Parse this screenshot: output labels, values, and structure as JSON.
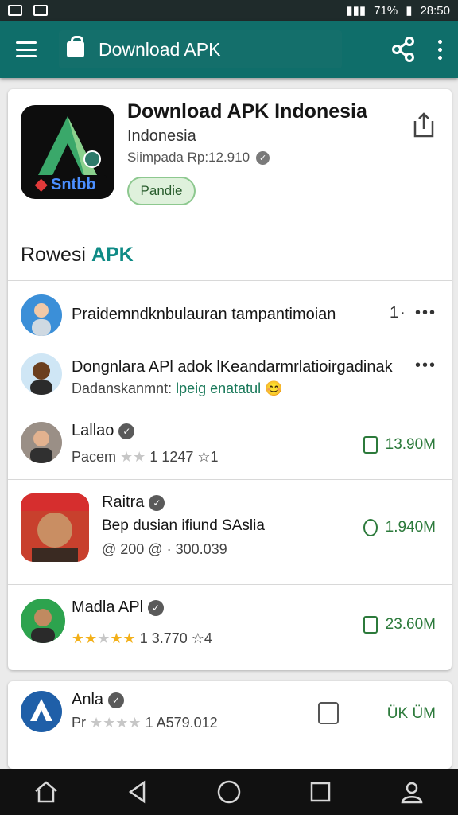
{
  "status": {
    "battery": "71%",
    "time": "28:50"
  },
  "appbar": {
    "title": "Download APK"
  },
  "app": {
    "title": "Download APK Indonesia",
    "subtitle": "Indonesia",
    "meta": "Siimpada Rp:12.910",
    "chip": "Pandie",
    "icon_text": "Sntbb"
  },
  "section": {
    "label": "Rowesi",
    "accent": "APK"
  },
  "rows": [
    {
      "title": "Praidemndknbulauran tampantimoian",
      "count": "1·",
      "more": "•••"
    },
    {
      "title": "Dongnlara APl adok lKeandarmrlatioirgadinak",
      "sub1": "Dadanskanmnt:",
      "sub2": "lpeig enatatul",
      "emoji": "😊",
      "more": "•••"
    },
    {
      "title": "Lallao",
      "sub": "Pacem",
      "stars_on": 0,
      "stars_text": "1 1247",
      "tail": "☆1",
      "size": "13.90M"
    },
    {
      "title": "Raitra",
      "desc": "Bep dusian ifiund SAslia",
      "sub": "@ 200 @ · 300.039",
      "size": "1.940M"
    },
    {
      "title": "Madla APl",
      "sub": "1 3.770",
      "tail": "☆4",
      "size": "23.60M"
    }
  ],
  "card2": {
    "title": "Anla",
    "sub": "Pr",
    "stars_text": "1 A579.012",
    "size": "ÜK ÜM"
  },
  "colors": {
    "teal": "#0f6e6a",
    "accent": "#0f8b86",
    "green": "#2c7a3b"
  }
}
